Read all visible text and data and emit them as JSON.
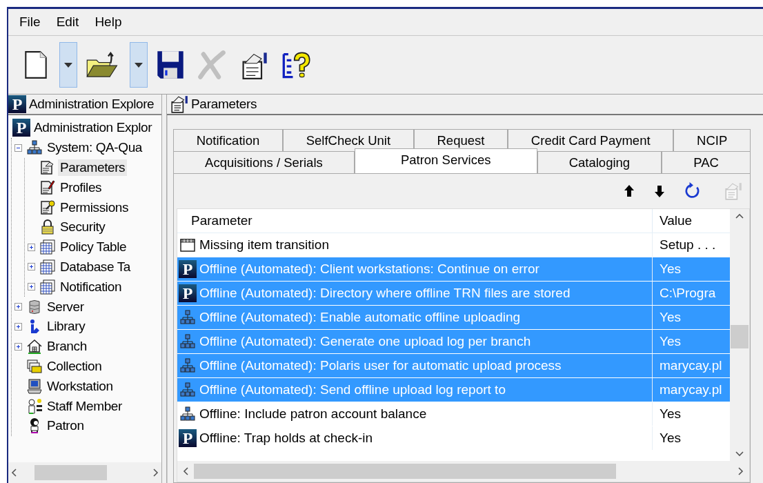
{
  "menu": [
    "File",
    "Edit",
    "Help"
  ],
  "toolbar": [
    {
      "kind": "new",
      "disabled": false
    },
    {
      "kind": "dropdown",
      "disabled": false
    },
    {
      "kind": "open",
      "disabled": false
    },
    {
      "kind": "dropdown",
      "disabled": false
    },
    {
      "kind": "save",
      "disabled": false
    },
    {
      "kind": "delete",
      "disabled": true
    },
    {
      "kind": "properties",
      "disabled": false
    },
    {
      "kind": "help",
      "disabled": false
    }
  ],
  "explorer": {
    "logo": "P",
    "title": "Administration Explore",
    "tree": [
      {
        "label": "Administration Explor",
        "kind": "polaris",
        "logo": "P",
        "selected": false,
        "children": [
          {
            "label": "System: QA-Qua",
            "kind": "org",
            "expanded": true,
            "selected": false,
            "children": [
              {
                "label": "Parameters",
                "kind": "parameters",
                "selected": true
              },
              {
                "label": "Profiles",
                "kind": "profiles",
                "selected": false
              },
              {
                "label": "Permissions",
                "kind": "permissions",
                "selected": false
              },
              {
                "label": "Security",
                "kind": "security",
                "selected": false
              },
              {
                "label": "Policy Table",
                "kind": "table",
                "expanded": false,
                "selected": false
              },
              {
                "label": "Database Ta",
                "kind": "table",
                "expanded": false,
                "selected": false
              },
              {
                "label": "Notification",
                "kind": "table",
                "expanded": false,
                "selected": false
              }
            ]
          },
          {
            "label": "Server",
            "kind": "server",
            "expanded": false,
            "selected": false
          },
          {
            "label": "Library",
            "kind": "library",
            "expanded": false,
            "selected": false
          },
          {
            "label": "Branch",
            "kind": "branch",
            "expanded": false,
            "selected": false
          },
          {
            "label": "Collection",
            "kind": "collection",
            "selected": false
          },
          {
            "label": "Workstation",
            "kind": "workstation",
            "selected": false
          },
          {
            "label": "Staff Member",
            "kind": "staff",
            "selected": false
          },
          {
            "label": "Patron",
            "kind": "patron",
            "selected": false
          }
        ]
      }
    ]
  },
  "parameters": {
    "title": "Parameters",
    "tab_rows": [
      [
        {
          "label": "Notification",
          "selected": false
        },
        {
          "label": "SelfCheck Unit",
          "selected": false
        },
        {
          "label": "Request",
          "selected": false
        },
        {
          "label": "Credit Card Payment",
          "selected": false
        },
        {
          "label": "NCIP",
          "selected": false
        }
      ],
      [
        {
          "label": "Acquisitions / Serials",
          "selected": false
        },
        {
          "label": "Patron Services",
          "selected": true
        },
        {
          "label": "Cataloging",
          "selected": false
        },
        {
          "label": "PAC",
          "selected": false
        }
      ]
    ],
    "actions": [
      {
        "kind": "up",
        "disabled": false
      },
      {
        "kind": "down",
        "disabled": false
      },
      {
        "kind": "refresh",
        "disabled": false
      },
      {
        "kind": "properties",
        "disabled": true
      }
    ],
    "columns": [
      "Parameter",
      "Value"
    ],
    "rows": [
      {
        "kind": "setup",
        "parameter": "Missing item transition",
        "value": "Setup . . .",
        "selected": false
      },
      {
        "kind": "polaris",
        "logo": "P",
        "parameter": "Offline (Automated): Client workstations: Continue on error",
        "value": "Yes",
        "selected": true
      },
      {
        "kind": "polaris",
        "logo": "P",
        "parameter": "Offline (Automated): Directory where offline TRN files are stored",
        "value": "C:\\Progra",
        "selected": true
      },
      {
        "kind": "org",
        "parameter": "Offline (Automated): Enable automatic offline uploading",
        "value": "Yes",
        "selected": true
      },
      {
        "kind": "org",
        "parameter": "Offline (Automated): Generate one upload log per branch",
        "value": "Yes",
        "selected": true
      },
      {
        "kind": "org",
        "parameter": "Offline (Automated): Polaris user for automatic upload process",
        "value": "marycay.pl",
        "selected": true
      },
      {
        "kind": "org",
        "parameter": "Offline (Automated): Send offline upload log report to",
        "value": "marycay.pl",
        "selected": true
      },
      {
        "kind": "org",
        "parameter": "Offline: Include patron account balance",
        "value": "Yes",
        "selected": false
      },
      {
        "kind": "polaris",
        "logo": "P",
        "parameter": "Offline: Trap holds at check-in",
        "value": "Yes",
        "selected": false
      }
    ]
  }
}
